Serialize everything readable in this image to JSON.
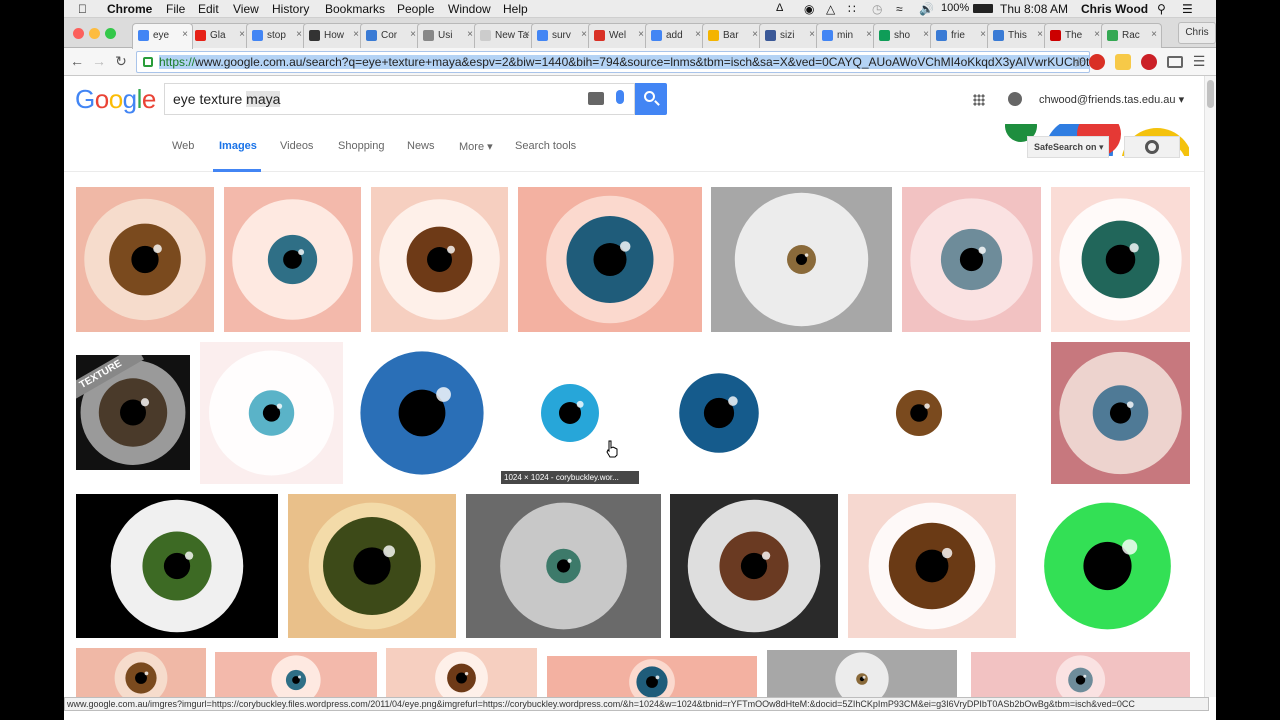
{
  "menubar": {
    "app": "Chrome",
    "items": [
      "File",
      "Edit",
      "View",
      "History",
      "Bookmarks",
      "People",
      "Window",
      "Help"
    ],
    "battery": "100%",
    "clock": "Thu 8:08 AM",
    "user": "Chris Wood"
  },
  "tabs": [
    {
      "label": "eye",
      "color": "#4285f4",
      "active": true
    },
    {
      "label": "Gla",
      "color": "#e62117"
    },
    {
      "label": "stop",
      "color": "#4285f4"
    },
    {
      "label": "How",
      "color": "#333333"
    },
    {
      "label": "Cor",
      "color": "#3a7bd5"
    },
    {
      "label": "Usi",
      "color": "#888888"
    },
    {
      "label": "New Ta",
      "color": "#cccccc"
    },
    {
      "label": "surv",
      "color": "#4285f4"
    },
    {
      "label": "Wel",
      "color": "#d93025"
    },
    {
      "label": "add",
      "color": "#4285f4"
    },
    {
      "label": "Bar",
      "color": "#f4b400"
    },
    {
      "label": "sizi",
      "color": "#3b5998"
    },
    {
      "label": "min",
      "color": "#4285f4"
    },
    {
      "label": "sho",
      "color": "#0f9d58"
    },
    {
      "label": "frie",
      "color": "#3a7bd5"
    },
    {
      "label": "This",
      "color": "#3a7bd5"
    },
    {
      "label": "The",
      "color": "#cc0000"
    },
    {
      "label": "Rac",
      "color": "#34a853"
    }
  ],
  "profile_button": "Chris",
  "omnibox": {
    "scheme": "https://",
    "url": "www.google.com.au/search?q=eye+texture+maya&espv=2&biw=1440&bih=794&source=lnms&tbm=isch&sa=X&ved=0CAYQ_AUoAWoVChMI4oKkqdX3yAIVwrKUCh0t"
  },
  "google": {
    "logo_letters": [
      {
        "ch": "G",
        "color": "#4285f4"
      },
      {
        "ch": "o",
        "color": "#ea4335"
      },
      {
        "ch": "o",
        "color": "#fbbc05"
      },
      {
        "ch": "g",
        "color": "#4285f4"
      },
      {
        "ch": "l",
        "color": "#34a853"
      },
      {
        "ch": "e",
        "color": "#ea4335"
      }
    ],
    "query_plain": "eye texture ",
    "query_highlight": "maya",
    "account": "chwood@friends.tas.edu.au ▾"
  },
  "nav": {
    "tabs": [
      {
        "label": "Web"
      },
      {
        "label": "Images",
        "selected": true
      },
      {
        "label": "Videos"
      },
      {
        "label": "Shopping"
      },
      {
        "label": "News"
      },
      {
        "label": "More ▾"
      },
      {
        "label": "Search tools"
      }
    ],
    "safesearch": "SafeSearch on ▾"
  },
  "images": {
    "hover_caption": "1024 × 1024 - corybuckley.wor...",
    "texture_label": "TEXTURE",
    "tiles": [
      {
        "bg": "#f0b8a6",
        "sclera": "#f7e2d2",
        "iris": "#7a4a1e",
        "r": 0.26
      },
      {
        "bg": "#f3b9ab",
        "sclera": "#fff1ea",
        "iris": "#2f6f86",
        "r": 0.18
      },
      {
        "bg": "#f6cfc0",
        "sclera": "#fff6f0",
        "iris": "#6e3a17",
        "r": 0.24
      },
      {
        "bg": "#f3b1a1",
        "sclera": "#fbe0d6",
        "iris": "#1f5c7a",
        "r": 0.3
      },
      {
        "bg": "#a7a7a7",
        "sclera": "#ececec",
        "iris": "#8a6a3a",
        "r": 0.1,
        "ball": true
      },
      {
        "bg": "#f2c2c2",
        "sclera": "#fbe7e7",
        "iris": "#6e8c9a",
        "r": 0.22
      },
      {
        "bg": "#fadcd6",
        "sclera": "#ffffff",
        "iris": "#21665a",
        "r": 0.28
      },
      {
        "bg": "#111111",
        "sclera": "#9a9a9a",
        "iris": "#4a3a2a",
        "r": 0.3,
        "ball": true
      },
      {
        "bg": "#fbeeee",
        "sclera": "#ffffff",
        "iris": "#5ab3c8",
        "r": 0.16
      },
      {
        "bg": "#ffffff",
        "sclera": "#ffffff",
        "iris": "#2a6fb7",
        "r": 0.44
      },
      {
        "bg": "#ffffff",
        "sclera": "#ffffff",
        "iris": "#27a6d9",
        "r": 0.21
      },
      {
        "bg": "#ffffff",
        "sclera": "#ffffff",
        "iris": "#155b8c",
        "r": 0.28
      },
      {
        "bg": "#ffffff",
        "sclera": "#ffffff",
        "iris": "#7a4a1e",
        "r": 0.18
      },
      {
        "bg": "#c7787e",
        "sclera": "#f3e3dc",
        "iris": "#4f7a96",
        "r": 0.2
      },
      {
        "bg": "#000000",
        "sclera": "#f0f0f0",
        "iris": "#3d6a24",
        "r": 0.24,
        "ball": true
      },
      {
        "bg": "#e9c08a",
        "sclera": "#f5dfae",
        "iris": "#3d4a18",
        "r": 0.34
      },
      {
        "bg": "#6a6a6a",
        "sclera": "#d8d8d8",
        "iris": "#3d7a6a",
        "r": 0.12
      },
      {
        "bg": "#2a2a2a",
        "sclera": "#dedede",
        "iris": "#6a3a22",
        "r": 0.24,
        "ball": true
      },
      {
        "bg": "#f6d8d0",
        "sclera": "#ffffff",
        "iris": "#6a3a15",
        "r": 0.3
      },
      {
        "bg": "#ffffff",
        "sclera": "#ffffff",
        "iris": "#33e055",
        "r": 0.44
      }
    ]
  },
  "statusbar": "www.google.com.au/imgres?imgurl=https://corybuckley.files.wordpress.com/2011/04/eye.png&imgrefurl=https://corybuckley.wordpress.com/&h=1024&w=1024&tbnid=rYFTmOOw8dHteM:&docid=5ZIhCKpImP93CM&ei=g3I6VryDPIbT0ASb2bOwBg&tbm=isch&ved=0CC"
}
